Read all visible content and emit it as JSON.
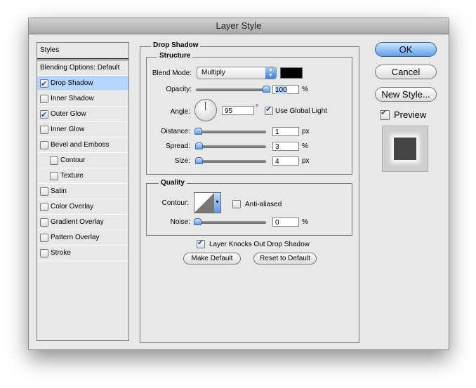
{
  "window": {
    "title": "Layer Style"
  },
  "styles_panel": {
    "header": "Styles",
    "items": [
      {
        "label": "Blending Options: Default",
        "has_checkbox": false,
        "checked": false,
        "selected": false,
        "sub": false
      },
      {
        "label": "Drop Shadow",
        "has_checkbox": true,
        "checked": true,
        "selected": true,
        "sub": false
      },
      {
        "label": "Inner Shadow",
        "has_checkbox": true,
        "checked": false,
        "selected": false,
        "sub": false
      },
      {
        "label": "Outer Glow",
        "has_checkbox": true,
        "checked": true,
        "selected": false,
        "sub": false
      },
      {
        "label": "Inner Glow",
        "has_checkbox": true,
        "checked": false,
        "selected": false,
        "sub": false
      },
      {
        "label": "Bevel and Emboss",
        "has_checkbox": true,
        "checked": false,
        "selected": false,
        "sub": false
      },
      {
        "label": "Contour",
        "has_checkbox": true,
        "checked": false,
        "selected": false,
        "sub": true
      },
      {
        "label": "Texture",
        "has_checkbox": true,
        "checked": false,
        "selected": false,
        "sub": true
      },
      {
        "label": "Satin",
        "has_checkbox": true,
        "checked": false,
        "selected": false,
        "sub": false
      },
      {
        "label": "Color Overlay",
        "has_checkbox": true,
        "checked": false,
        "selected": false,
        "sub": false
      },
      {
        "label": "Gradient Overlay",
        "has_checkbox": true,
        "checked": false,
        "selected": false,
        "sub": false
      },
      {
        "label": "Pattern Overlay",
        "has_checkbox": true,
        "checked": false,
        "selected": false,
        "sub": false
      },
      {
        "label": "Stroke",
        "has_checkbox": true,
        "checked": false,
        "selected": false,
        "sub": false
      }
    ]
  },
  "drop_shadow": {
    "title": "Drop Shadow",
    "structure": {
      "title": "Structure",
      "blend_mode_label": "Blend Mode:",
      "blend_mode_value": "Multiply",
      "shadow_color": "#000000",
      "opacity_label": "Opacity:",
      "opacity_value": "100",
      "opacity_unit": "%",
      "opacity_fraction": 1.0,
      "angle_label": "Angle:",
      "angle_value": "95",
      "angle_unit": "°",
      "use_global_light_label": "Use Global Light",
      "use_global_light_checked": true,
      "distance_label": "Distance:",
      "distance_value": "1",
      "distance_unit": "px",
      "spread_label": "Spread:",
      "spread_value": "3",
      "spread_unit": "%",
      "size_label": "Size:",
      "size_value": "4",
      "size_unit": "px"
    },
    "quality": {
      "title": "Quality",
      "contour_label": "Contour:",
      "anti_aliased_label": "Anti-aliased",
      "anti_aliased_checked": false,
      "noise_label": "Noise:",
      "noise_value": "0",
      "noise_unit": "%"
    },
    "knocks_out_label": "Layer Knocks Out Drop Shadow",
    "knocks_out_checked": true,
    "make_default_label": "Make Default",
    "reset_default_label": "Reset to Default"
  },
  "actions": {
    "ok_label": "OK",
    "cancel_label": "Cancel",
    "new_style_label": "New Style...",
    "preview_label": "Preview",
    "preview_checked": true
  }
}
